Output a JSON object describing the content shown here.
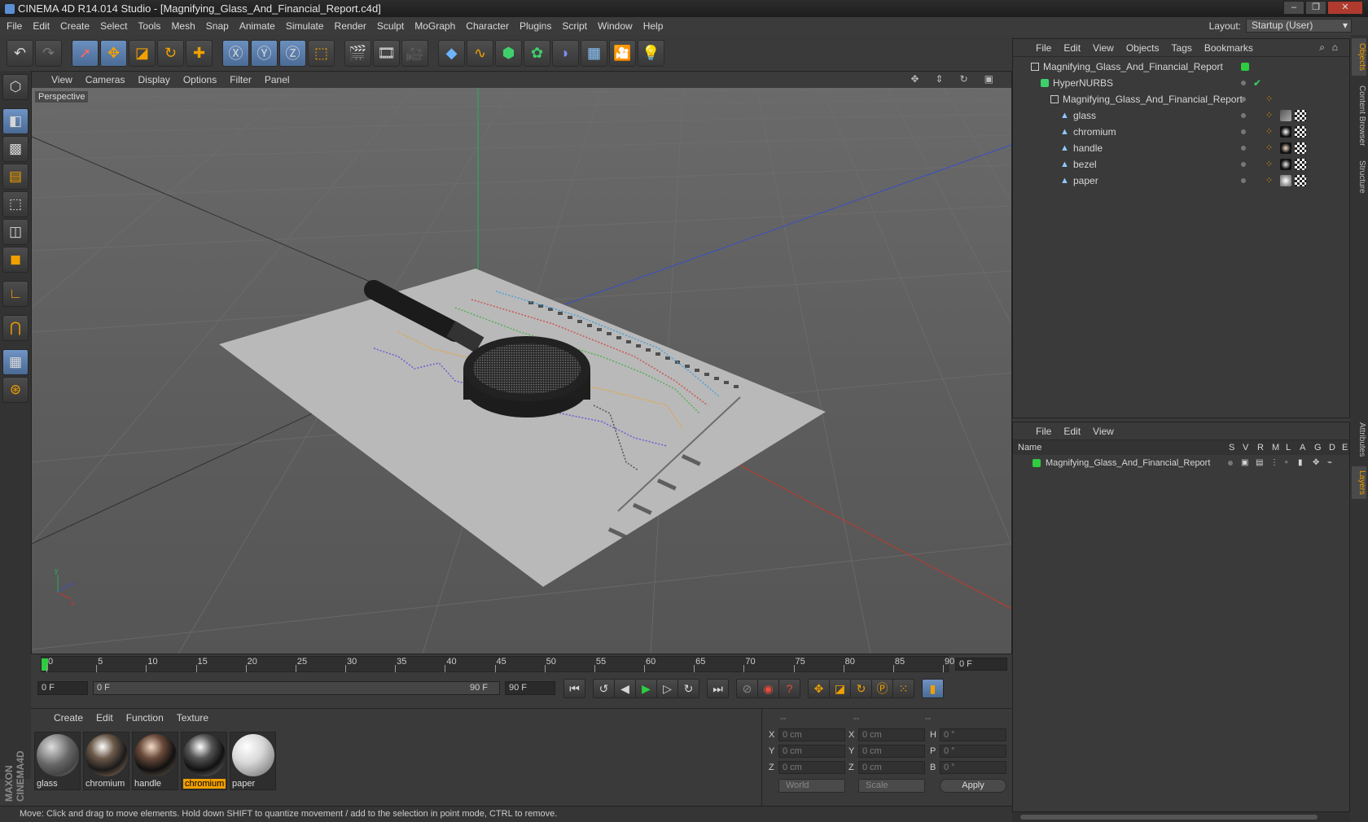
{
  "window": {
    "title": "CINEMA 4D R14.014 Studio - [Magnifying_Glass_And_Financial_Report.c4d]"
  },
  "menu": [
    "File",
    "Edit",
    "Create",
    "Select",
    "Tools",
    "Mesh",
    "Snap",
    "Animate",
    "Simulate",
    "Render",
    "Sculpt",
    "MoGraph",
    "Character",
    "Plugins",
    "Script",
    "Window",
    "Help"
  ],
  "layout": {
    "label": "Layout:",
    "value": "Startup (User)"
  },
  "viewport": {
    "menu": [
      "View",
      "Cameras",
      "Display",
      "Options",
      "Filter",
      "Panel"
    ],
    "label": "Perspective"
  },
  "timeline": {
    "ticks": [
      "0",
      "5",
      "10",
      "15",
      "20",
      "25",
      "30",
      "35",
      "40",
      "45",
      "50",
      "55",
      "60",
      "65",
      "70",
      "75",
      "80",
      "85",
      "90"
    ],
    "current_frame": "0 F"
  },
  "transport": {
    "start": "0 F",
    "range_start": "0 F",
    "range_end": "90 F",
    "end": "90 F"
  },
  "materials": {
    "menu": [
      "Create",
      "Edit",
      "Function",
      "Texture"
    ],
    "items": [
      {
        "name": "glass"
      },
      {
        "name": "chromium"
      },
      {
        "name": "handle"
      },
      {
        "name": "chromium",
        "selected": true
      },
      {
        "name": "paper"
      }
    ]
  },
  "coords": {
    "headers": [
      "--",
      "--",
      "--"
    ],
    "rows": [
      {
        "a": "X",
        "av": "0 cm",
        "b": "X",
        "bv": "0 cm",
        "c": "H",
        "cv": "0 °"
      },
      {
        "a": "Y",
        "av": "0 cm",
        "b": "Y",
        "bv": "0 cm",
        "c": "P",
        "cv": "0 °"
      },
      {
        "a": "Z",
        "av": "0 cm",
        "b": "Z",
        "bv": "0 cm",
        "c": "B",
        "cv": "0 °"
      }
    ],
    "mode1": "World",
    "mode2": "Scale",
    "apply": "Apply"
  },
  "status": "Move: Click and drag to move elements. Hold down SHIFT to quantize movement / add to the selection in point mode, CTRL to remove.",
  "objects": {
    "menu": [
      "File",
      "Edit",
      "View",
      "Objects",
      "Tags",
      "Bookmarks"
    ],
    "items": [
      {
        "name": "Magnifying_Glass_And_Financial_Report",
        "level": 0
      },
      {
        "name": "HyperNURBS",
        "level": 1
      },
      {
        "name": "Magnifying_Glass_And_Financial_Report",
        "level": 2
      },
      {
        "name": "glass",
        "level": 3
      },
      {
        "name": "chromium",
        "level": 3
      },
      {
        "name": "handle",
        "level": 3
      },
      {
        "name": "bezel",
        "level": 3
      },
      {
        "name": "paper",
        "level": 3
      }
    ]
  },
  "layers": {
    "menu": [
      "File",
      "Edit",
      "View"
    ],
    "columns": [
      "Name",
      "S",
      "V",
      "R",
      "M",
      "L",
      "A",
      "G",
      "D",
      "E"
    ],
    "items": [
      {
        "name": "Magnifying_Glass_And_Financial_Report"
      }
    ]
  },
  "sidetabs": [
    "Objects",
    "Content Browser",
    "Structure",
    "Attributes",
    "Layers"
  ],
  "colors": {
    "accent": "#f0a000",
    "layer_green": "#2ecc40",
    "axis_x": "#c0392b",
    "axis_y": "#27ae60",
    "axis_z": "#3a4fc4"
  }
}
